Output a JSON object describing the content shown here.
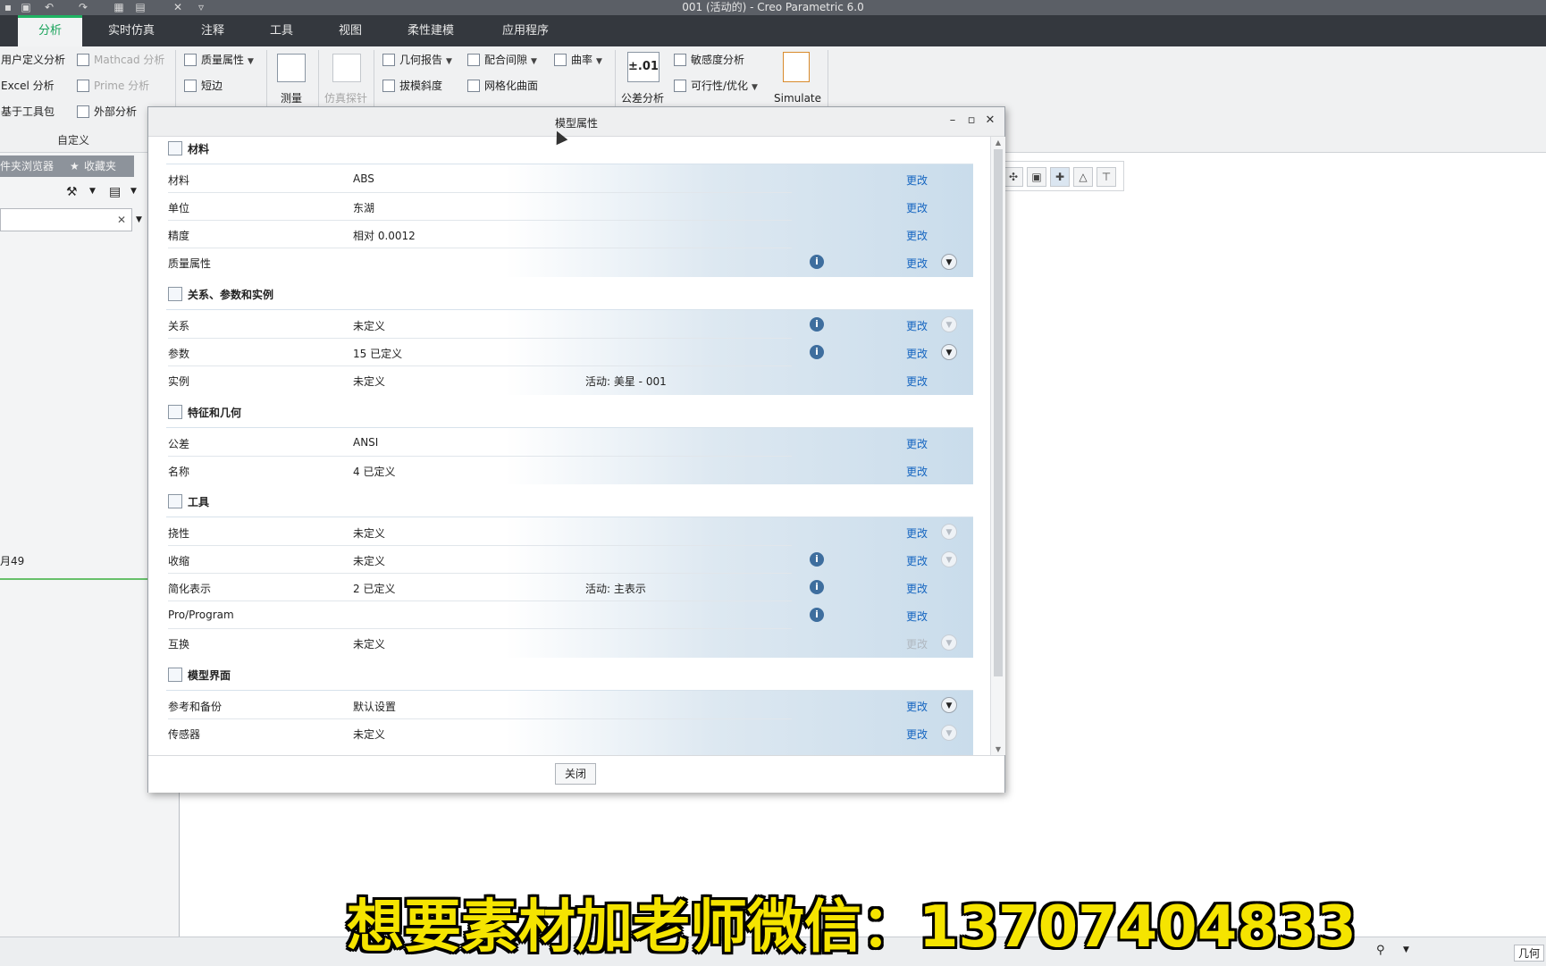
{
  "window": {
    "title": "001 (活动的) - Creo Parametric 6.0"
  },
  "tabs": [
    {
      "label": "分析",
      "active": true
    },
    {
      "label": "实时仿真"
    },
    {
      "label": "注释"
    },
    {
      "label": "工具"
    },
    {
      "label": "视图"
    },
    {
      "label": "柔性建模"
    },
    {
      "label": "应用程序"
    }
  ],
  "ribbon": {
    "user_def_analysis": "用户定义分析",
    "excel_analysis": "Excel 分析",
    "toolkit_based": "基于工具包",
    "mathcad_analysis": "Mathcad 分析",
    "prime_analysis": "Prime 分析",
    "external_analysis": "外部分析",
    "group_custom": "自定义",
    "mass_properties": "质量属性",
    "short_edge": "短边",
    "measure": "测量",
    "sim_probe": "仿真探针",
    "geometry_report": "几何报告",
    "draft": "拔模斜度",
    "mating_clearance": "配合间隙",
    "mesh_surface": "网格化曲面",
    "curvature": "曲率",
    "tolerance_badge": "±.01",
    "tolerance_analysis": "公差分析",
    "sensitivity": "敏感度分析",
    "feasibility": "可行性/优化",
    "simulate": "Simulate"
  },
  "leftpanel": {
    "folder_browser": "件夹浏览器",
    "favorites": "收藏夹",
    "tree_fragment": "月49"
  },
  "dialog": {
    "title": "模型属性",
    "change_label": "更改",
    "close_button": "关闭",
    "sections": {
      "material": "材料",
      "relations": "关系、参数和实例",
      "features": "特征和几何",
      "tools": "工具",
      "interface": "模型界面"
    },
    "rows": {
      "material": {
        "key": "材料",
        "value": "ABS"
      },
      "units": {
        "key": "单位",
        "value": "东湖"
      },
      "accuracy": {
        "key": "精度",
        "value": "相对 0.0012"
      },
      "massprops": {
        "key": "质量属性",
        "value": ""
      },
      "relations": {
        "key": "关系",
        "value": "未定义"
      },
      "parameters": {
        "key": "参数",
        "value": "15 已定义"
      },
      "instances": {
        "key": "实例",
        "value": "未定义",
        "extra": "活动: 美星 - 001"
      },
      "tolerance": {
        "key": "公差",
        "value": "ANSI"
      },
      "names": {
        "key": "名称",
        "value": "4 已定义"
      },
      "flexibility": {
        "key": "挠性",
        "value": "未定义"
      },
      "shrinkage": {
        "key": "收缩",
        "value": "未定义"
      },
      "simprep": {
        "key": "简化表示",
        "value": "2 已定义",
        "extra": "活动: 主表示"
      },
      "proprogram": {
        "key": "Pro/Program",
        "value": ""
      },
      "interchange": {
        "key": "互换",
        "value": "未定义"
      },
      "refs": {
        "key": "参考和备份",
        "value": "默认设置"
      },
      "sensors": {
        "key": "传感器",
        "value": "未定义"
      }
    }
  },
  "status": {
    "right_label": "几何"
  },
  "banner": "想要素材加老师微信：13707404833"
}
